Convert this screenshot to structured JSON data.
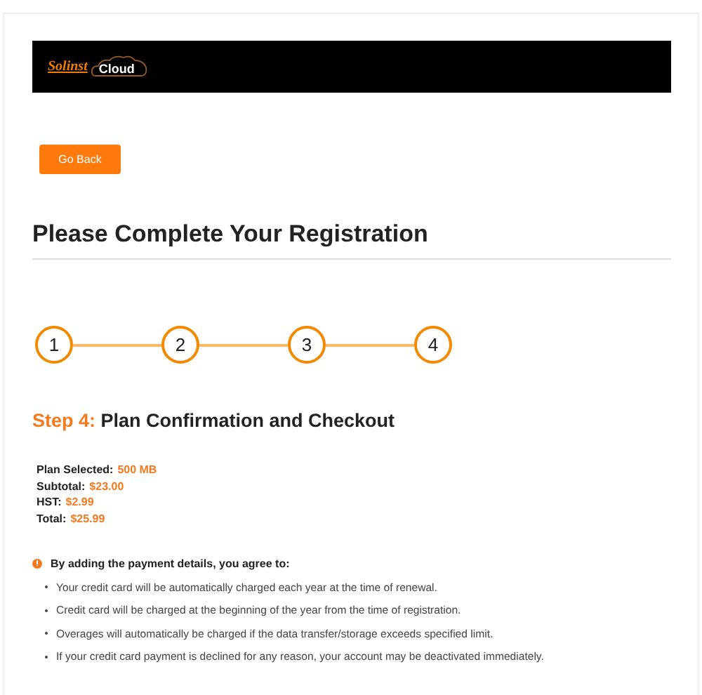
{
  "header": {
    "logo_brand": "Solinst",
    "logo_product": "Cloud"
  },
  "back_button": "Go Back",
  "title": "Please Complete Your Registration",
  "steps": [
    {
      "label": "1"
    },
    {
      "label": "2"
    },
    {
      "label": "3"
    },
    {
      "label": "4"
    }
  ],
  "step_heading": {
    "prefix": "Step 4:",
    "text": "Plan Confirmation and Checkout"
  },
  "summary": [
    {
      "label": "Plan Selected:",
      "value": "500 MB"
    },
    {
      "label": "Subtotal:",
      "value": "$23.00"
    },
    {
      "label": "HST:",
      "value": "$2.99"
    },
    {
      "label": "Total:",
      "value": "$25.99"
    }
  ],
  "agreement": {
    "heading": "By adding the payment details, you agree to:",
    "items": [
      "Your credit card will be automatically charged each year at the time of renewal.",
      "Credit card will be charged at the beginning of the year from the time of registration.",
      "Overages will automatically be charged if the data transfer/storage exceeds specified limit.",
      "If your credit card payment is declined for any reason, your account may be deactivated immediately."
    ]
  }
}
